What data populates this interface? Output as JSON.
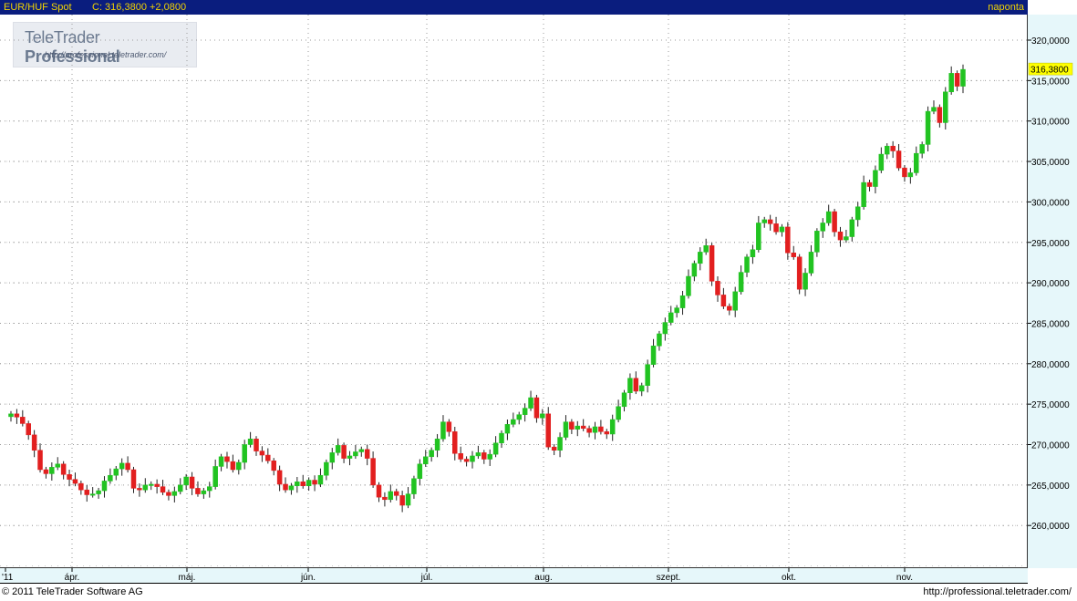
{
  "header": {
    "symbol": "EUR/HUF Spot",
    "close_label": "C: 316,3800 +2,0800",
    "frequency": "naponta"
  },
  "logo": {
    "brand_regular": "TeleTrader ",
    "brand_bold": "Professional",
    "url": "http://professional.teletrader.com/"
  },
  "footer": {
    "copyright": "© 2011 TeleTrader Software AG",
    "url": "http://professional.teletrader.com/"
  },
  "colors": {
    "up": "#21c321",
    "down": "#e21f1f",
    "title_bg": "#0a1d7e",
    "title_text": "#f2d400",
    "axis_bg": "#e6f7fa",
    "last_price_bg": "#ffff00"
  },
  "chart_data": {
    "type": "candlestick",
    "title": "EUR/HUF Spot",
    "last_price_label": "316,3800",
    "y_ticks": [
      "320,0000",
      "315,0000",
      "310,0000",
      "305,0000",
      "300,0000",
      "295,0000",
      "290,0000",
      "285,0000",
      "280,0000",
      "275,0000",
      "270,0000",
      "265,0000",
      "260,0000"
    ],
    "ylim": [
      255.5,
      324.5
    ],
    "x_ticks": [
      "'11",
      "ápr.",
      "máj.",
      "jún.",
      "júl.",
      "aug.",
      "szept.",
      "okt.",
      "nov."
    ],
    "grid": true,
    "closes": [
      273.8,
      273.4,
      272.6,
      271.2,
      269.3,
      266.9,
      266.4,
      267.2,
      267.6,
      266.3,
      265.7,
      265.2,
      264.4,
      263.8,
      263.9,
      264.3,
      265.5,
      266.2,
      267.0,
      267.7,
      266.9,
      264.6,
      264.4,
      265.0,
      265.1,
      264.8,
      264.1,
      263.7,
      264.2,
      265.0,
      266.0,
      264.6,
      263.9,
      264.3,
      264.8,
      267.3,
      268.5,
      267.9,
      266.9,
      267.8,
      270.0,
      270.7,
      269.2,
      268.7,
      268.0,
      266.8,
      265.1,
      264.4,
      264.9,
      265.4,
      264.9,
      265.6,
      265.1,
      266.2,
      267.8,
      269.0,
      269.9,
      268.3,
      268.6,
      269.1,
      269.4,
      268.3,
      265.0,
      263.5,
      263.2,
      264.2,
      263.7,
      262.5,
      263.9,
      265.8,
      267.6,
      268.5,
      269.3,
      270.7,
      272.8,
      271.6,
      268.9,
      268.2,
      267.9,
      268.6,
      269.0,
      268.2,
      268.8,
      270.2,
      271.4,
      272.5,
      273.1,
      273.7,
      274.5,
      275.8,
      273.3,
      273.8,
      269.7,
      269.3,
      270.9,
      272.8,
      271.9,
      272.3,
      272.0,
      271.5,
      272.2,
      271.6,
      271.3,
      273.1,
      274.7,
      276.4,
      278.2,
      276.6,
      277.3,
      279.9,
      282.2,
      283.7,
      285.1,
      286.3,
      286.9,
      288.4,
      290.8,
      292.4,
      293.8,
      294.6,
      290.2,
      288.5,
      287.1,
      286.6,
      288.9,
      291.3,
      293.2,
      294.1,
      297.4,
      297.8,
      297.3,
      296.3,
      296.9,
      293.7,
      293.2,
      289.2,
      291.2,
      293.8,
      296.4,
      297.4,
      298.8,
      296.3,
      295.3,
      295.7,
      297.8,
      299.4,
      302.4,
      301.9,
      303.9,
      305.9,
      306.9,
      306.3,
      304.2,
      303.1,
      303.6,
      306.0,
      307.1,
      311.2,
      311.7,
      309.8,
      313.6,
      315.9,
      314.3,
      316.38
    ]
  }
}
